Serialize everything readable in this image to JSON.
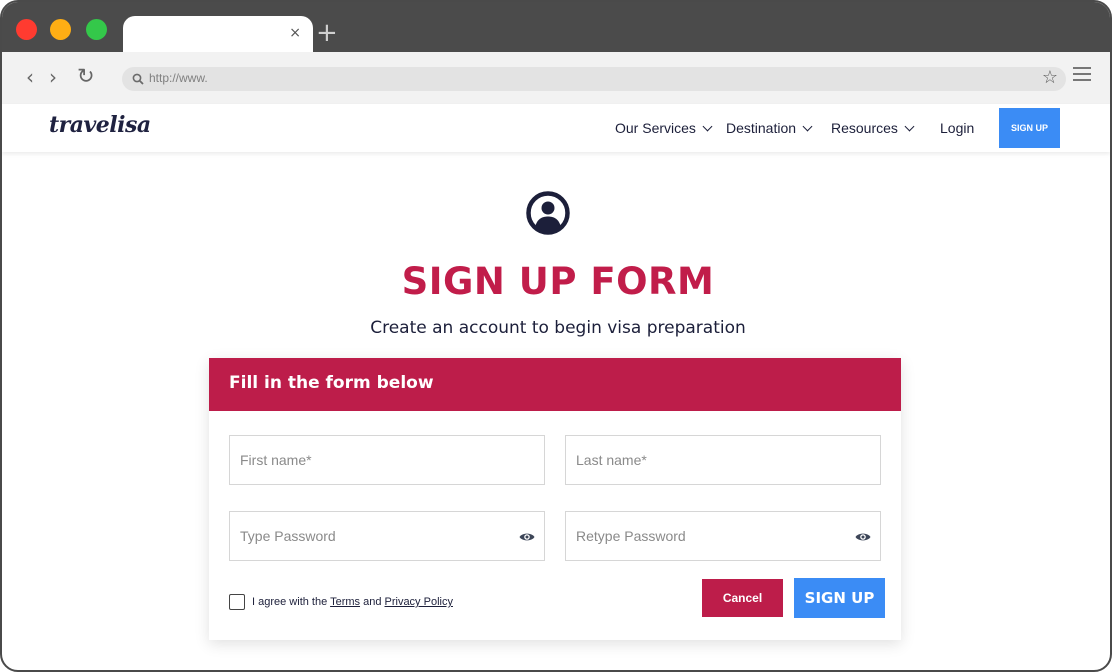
{
  "browser": {
    "tab_close": "×",
    "new_tab": "+",
    "back": "‹",
    "forward": "›",
    "reload": "↻",
    "search_glyph": "⚲",
    "url": "http://www.",
    "star": "☆",
    "icons": [
      "back-icon",
      "forward-icon",
      "reload-icon",
      "search-icon",
      "star-icon",
      "menu-icon",
      "close-icon",
      "plus-icon"
    ]
  },
  "header": {
    "logo": "travelisa",
    "nav": [
      {
        "label": "Our Services",
        "has_dropdown": true
      },
      {
        "label": "Destination",
        "has_dropdown": true
      },
      {
        "label": "Resources",
        "has_dropdown": true
      },
      {
        "label": "Login",
        "has_dropdown": false
      }
    ],
    "signup_label": "SIGN UP"
  },
  "main": {
    "icon": "user-circle-icon",
    "title": "SIGN UP FORM",
    "subtitle": "Create an account to begin visa preparation"
  },
  "form": {
    "header": "Fill in the form below",
    "first_name_placeholder": "First name*",
    "last_name_placeholder": "Last name*",
    "password_placeholder": "Type Password",
    "retype_password_placeholder": "Retype Password",
    "agree_prefix": "I agree with the ",
    "terms_label": "Terms",
    "agree_and": " and ",
    "privacy_label": "Privacy Policy",
    "cancel_label": "Cancel",
    "submit_label": "SIGN UP"
  },
  "colors": {
    "brand_red": "#bd1d4a",
    "brand_blue": "#3b8cf5",
    "text_dark": "#1c1f3a",
    "chrome_dark": "#4b4b4b"
  }
}
